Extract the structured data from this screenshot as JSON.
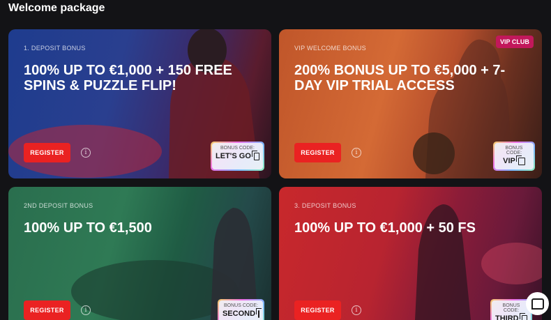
{
  "page": {
    "title": "Welcome package"
  },
  "cards": [
    {
      "label": "1. DEPOSIT BONUS",
      "headline": "100% UP TO €1,000 + 150 FREE SPINS & PUZZLE FLIP!",
      "register": "REGISTER",
      "info": "i",
      "code_caption": "BONUS CODE:",
      "code": "LET'S GO"
    },
    {
      "label": "VIP WELCOME BONUS",
      "headline": "200% BONUS UP TO €5,000 + 7-DAY VIP TRIAL ACCESS",
      "register": "REGISTER",
      "info": "i",
      "code_caption": "BONUS CODE:",
      "code": "VIP",
      "badge": "VIP CLUB"
    },
    {
      "label": "2ND DEPOSIT BONUS",
      "headline": "100% UP TO €1,500",
      "register": "REGISTER",
      "info": "i",
      "code_caption": "BONUS CODE:",
      "code": "SECOND"
    },
    {
      "label": "3. DEPOSIT BONUS",
      "headline": "100% UP TO €1,000 + 50 FS",
      "register": "REGISTER",
      "info": "i",
      "code_caption": "BONUS CODE:",
      "code": "THIRD"
    }
  ],
  "colors": {
    "register": "#ea2222",
    "vip_badge": "#c2185b",
    "background": "#131316"
  },
  "icons": {
    "info": "info-icon",
    "copy": "copy-icon",
    "chat": "chat-icon"
  }
}
